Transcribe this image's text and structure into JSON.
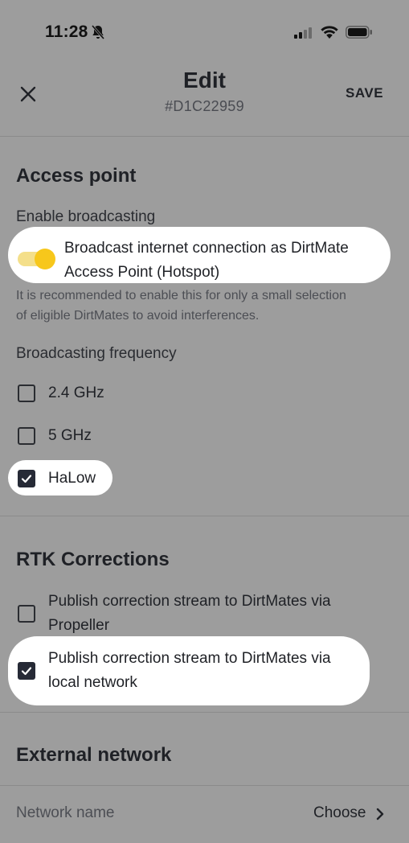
{
  "status_bar": {
    "time": "11:28",
    "icons": [
      "bell-slash-icon",
      "signal-icon",
      "wifi-icon",
      "battery-icon"
    ]
  },
  "header": {
    "title": "Edit",
    "subtitle": "#D1C22959",
    "save_label": "SAVE",
    "close_icon": "close-icon"
  },
  "access_point": {
    "section_title": "Access point",
    "enable_label": "Enable broadcasting",
    "toggle_on": true,
    "toggle_line1": "Broadcast internet connection as DirtMate",
    "toggle_line2": "Access Point (Hotspot)",
    "helper_line1": "It is recommended to enable this for only a small selection",
    "helper_line2": "of eligible DirtMates to avoid interferences.",
    "frequency_label": "Broadcasting frequency",
    "frequencies": [
      {
        "label": "2.4 GHz",
        "checked": false
      },
      {
        "label": "5 GHz",
        "checked": false
      },
      {
        "label": "HaLow",
        "checked": true
      }
    ]
  },
  "rtk": {
    "section_title": "RTK Corrections",
    "options": [
      {
        "line1": "Publish correction stream to DirtMates via",
        "line2": "Propeller",
        "checked": false
      },
      {
        "line1": "Publish correction stream to DirtMates via",
        "line2": "local network",
        "checked": true
      }
    ]
  },
  "external_network": {
    "section_title": "External network",
    "network_name_label": "Network name",
    "choose_label": "Choose"
  },
  "colors": {
    "overlay_bg": "#9d9d9d",
    "highlight": "#ffffff",
    "accent_yellow": "#f7c71b",
    "checkbox_dark": "#262a36"
  }
}
